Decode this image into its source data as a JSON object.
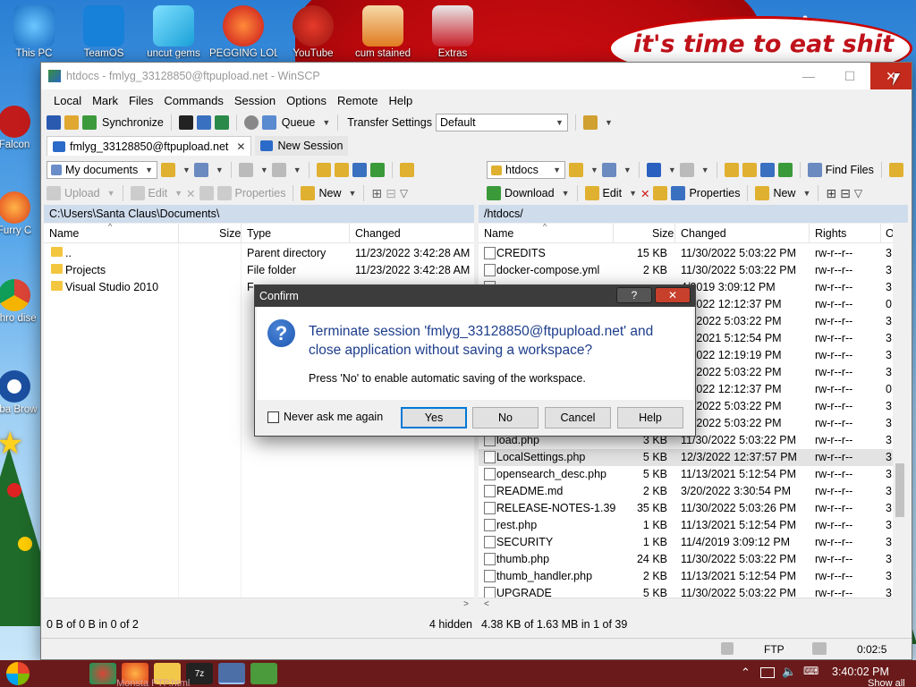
{
  "desktop": {
    "banner_text": "it's time to eat shit",
    "icons": [
      {
        "label": "This PC"
      },
      {
        "label": "TeamOS"
      },
      {
        "label": "uncut gems"
      },
      {
        "label": "PEGGING LOL"
      },
      {
        "label": "YouTube"
      },
      {
        "label": "cum stained"
      },
      {
        "label": "Extras"
      },
      {
        "label": "Falcon"
      },
      {
        "label": "Furry C"
      },
      {
        "label": "Chro dise"
      },
      {
        "label": "Oba Brow"
      }
    ]
  },
  "window": {
    "title": "htdocs - fmlyg_33128850@ftpupload.net - WinSCP",
    "menu": [
      "Local",
      "Mark",
      "Files",
      "Commands",
      "Session",
      "Options",
      "Remote",
      "Help"
    ],
    "toolbar": {
      "synchronize": "Synchronize",
      "queue": "Queue",
      "transfer_settings_label": "Transfer Settings",
      "transfer_settings_value": "Default"
    },
    "tabs": {
      "session": "fmlyg_33128850@ftpupload.net",
      "new_session": "New Session"
    },
    "local": {
      "location": "My documents",
      "actions": {
        "upload": "Upload",
        "edit": "Edit",
        "properties": "Properties",
        "new": "New"
      },
      "path": "C:\\Users\\Santa Claus\\Documents\\",
      "columns": {
        "name": "Name",
        "size": "Size",
        "type": "Type",
        "changed": "Changed"
      },
      "rows": [
        {
          "name": "..",
          "size": "",
          "type": "Parent directory",
          "changed": "11/23/2022  3:42:28 AM"
        },
        {
          "name": "Projects",
          "size": "",
          "type": "File folder",
          "changed": "11/23/2022  3:42:28 AM"
        },
        {
          "name": "Visual Studio 2010",
          "size": "",
          "type": "F",
          "changed": ""
        }
      ],
      "status": "0 B of 0 B in 0 of 2",
      "hidden": "4 hidden"
    },
    "remote": {
      "location": "htdocs",
      "find_files": "Find Files",
      "actions": {
        "download": "Download",
        "edit": "Edit",
        "properties": "Properties",
        "new": "New"
      },
      "path": "/htdocs/",
      "columns": {
        "name": "Name",
        "size": "Size",
        "changed": "Changed",
        "rights": "Rights",
        "owner": "O"
      },
      "rows": [
        {
          "name": "CREDITS",
          "size": "15 KB",
          "changed": "11/30/2022 5:03:22 PM",
          "rights": "rw-r--r--",
          "owner": "3"
        },
        {
          "name": "docker-compose.yml",
          "size": "2 KB",
          "changed": "11/30/2022 5:03:22 PM",
          "rights": "rw-r--r--",
          "owner": "3"
        },
        {
          "name": "",
          "size": "",
          "changed": "4/2019 3:09:12 PM",
          "rights": "rw-r--r--",
          "owner": "3"
        },
        {
          "name": "",
          "size": "",
          "changed": "3/2022 12:12:37 PM",
          "rights": "rw-r--r--",
          "owner": "0"
        },
        {
          "name": "",
          "size": "",
          "changed": "30/2022 5:03:22 PM",
          "rights": "rw-r--r--",
          "owner": "3"
        },
        {
          "name": "",
          "size": "",
          "changed": "13/2021 5:12:54 PM",
          "rights": "rw-r--r--",
          "owner": "3"
        },
        {
          "name": "",
          "size": "",
          "changed": "3/2022 12:19:19 PM",
          "rights": "rw-r--r--",
          "owner": "3"
        },
        {
          "name": "",
          "size": "",
          "changed": "30/2022 5:03:22 PM",
          "rights": "rw-r--r--",
          "owner": "3"
        },
        {
          "name": "",
          "size": "",
          "changed": "3/2022 12:12:37 PM",
          "rights": "rw-r--r--",
          "owner": "0"
        },
        {
          "name": "",
          "size": "",
          "changed": "30/2022 5:03:22 PM",
          "rights": "rw-r--r--",
          "owner": "3"
        },
        {
          "name": "",
          "size": "",
          "changed": "30/2022 5:03:22 PM",
          "rights": "rw-r--r--",
          "owner": "3"
        },
        {
          "name": "load.php",
          "size": "3 KB",
          "changed": "11/30/2022 5:03:22 PM",
          "rights": "rw-r--r--",
          "owner": "3"
        },
        {
          "name": "LocalSettings.php",
          "size": "5 KB",
          "changed": "12/3/2022 12:37:57 PM",
          "rights": "rw-r--r--",
          "owner": "3"
        },
        {
          "name": "opensearch_desc.php",
          "size": "5 KB",
          "changed": "11/13/2021 5:12:54 PM",
          "rights": "rw-r--r--",
          "owner": "3"
        },
        {
          "name": "README.md",
          "size": "2 KB",
          "changed": "3/20/2022 3:30:54 PM",
          "rights": "rw-r--r--",
          "owner": "3"
        },
        {
          "name": "RELEASE-NOTES-1.39",
          "size": "35 KB",
          "changed": "11/30/2022 5:03:26 PM",
          "rights": "rw-r--r--",
          "owner": "3"
        },
        {
          "name": "rest.php",
          "size": "1 KB",
          "changed": "11/13/2021 5:12:54 PM",
          "rights": "rw-r--r--",
          "owner": "3"
        },
        {
          "name": "SECURITY",
          "size": "1 KB",
          "changed": "11/4/2019 3:09:12 PM",
          "rights": "rw-r--r--",
          "owner": "3"
        },
        {
          "name": "thumb.php",
          "size": "24 KB",
          "changed": "11/30/2022 5:03:22 PM",
          "rights": "rw-r--r--",
          "owner": "3"
        },
        {
          "name": "thumb_handler.php",
          "size": "2 KB",
          "changed": "11/13/2021 5:12:54 PM",
          "rights": "rw-r--r--",
          "owner": "3"
        },
        {
          "name": "UPGRADE",
          "size": "5 KB",
          "changed": "11/30/2022 5:03:22 PM",
          "rights": "rw-r--r--",
          "owner": "3"
        }
      ],
      "status": "4.38 KB of 1.63 MB in 1 of 39"
    },
    "bottom": {
      "protocol": "FTP",
      "elapsed": "0:02:5"
    }
  },
  "dialog": {
    "title": "Confirm",
    "help_glyph": "?",
    "close_glyph": "✕",
    "message": "Terminate session 'fmlyg_33128850@ftpupload.net' and close application without saving a workspace?",
    "hint": "Press 'No' to enable automatic saving of the workspace.",
    "checkbox": "Never ask me again",
    "buttons": {
      "yes": "Yes",
      "no": "No",
      "cancel": "Cancel",
      "help": "Help"
    }
  },
  "taskbar": {
    "clock": "3:40:02 PM",
    "show_all": "Show all",
    "item_label": "Monsta FTP.html"
  },
  "colors": {
    "dialog_text": "#1d3d8c",
    "close": "#c42b1c",
    "path_bar": "#cfdcec",
    "taskbar": "#6a1a1a"
  }
}
